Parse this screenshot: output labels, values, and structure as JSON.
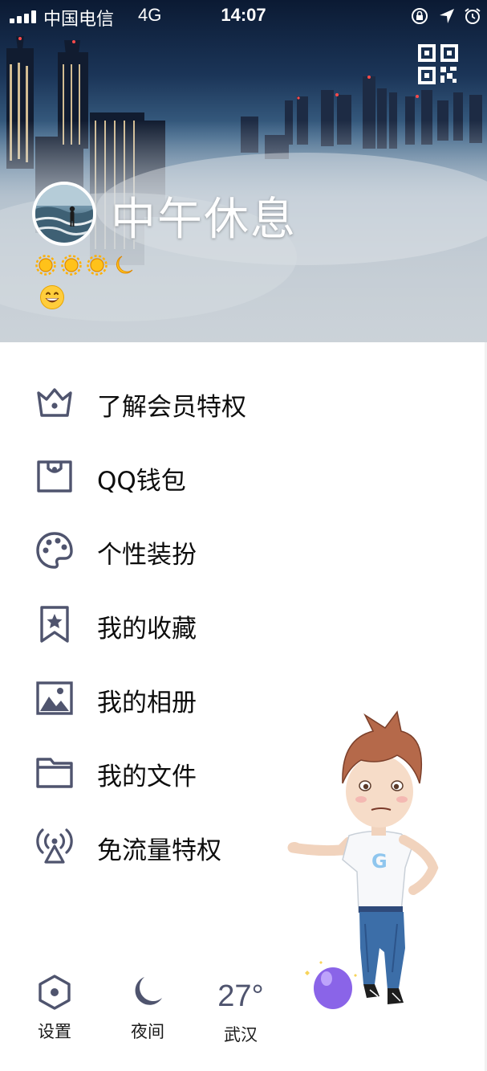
{
  "status_bar": {
    "carrier": "中国电信",
    "network": "4G",
    "time": "14:07"
  },
  "profile": {
    "nickname": "中午休息",
    "level_icons": [
      "sun-icon",
      "sun-icon",
      "sun-icon",
      "moon-icon"
    ],
    "mood_icon": "grinning-face-icon"
  },
  "menu": {
    "items": [
      {
        "label": "了解会员特权",
        "icon": "crown-icon"
      },
      {
        "label": "QQ钱包",
        "icon": "wallet-icon"
      },
      {
        "label": "个性装扮",
        "icon": "palette-icon"
      },
      {
        "label": "我的收藏",
        "icon": "bookmark-star-icon"
      },
      {
        "label": "我的相册",
        "icon": "photo-icon"
      },
      {
        "label": "我的文件",
        "icon": "folder-icon"
      },
      {
        "label": "免流量特权",
        "icon": "antenna-icon"
      }
    ]
  },
  "bottom_bar": {
    "settings_label": "设置",
    "night_label": "夜间",
    "weather_temp": "27°",
    "weather_city": "武汉"
  },
  "colors": {
    "icon_gray": "#4f546e",
    "text": "#0d0d0d",
    "background": "#ffffff"
  }
}
